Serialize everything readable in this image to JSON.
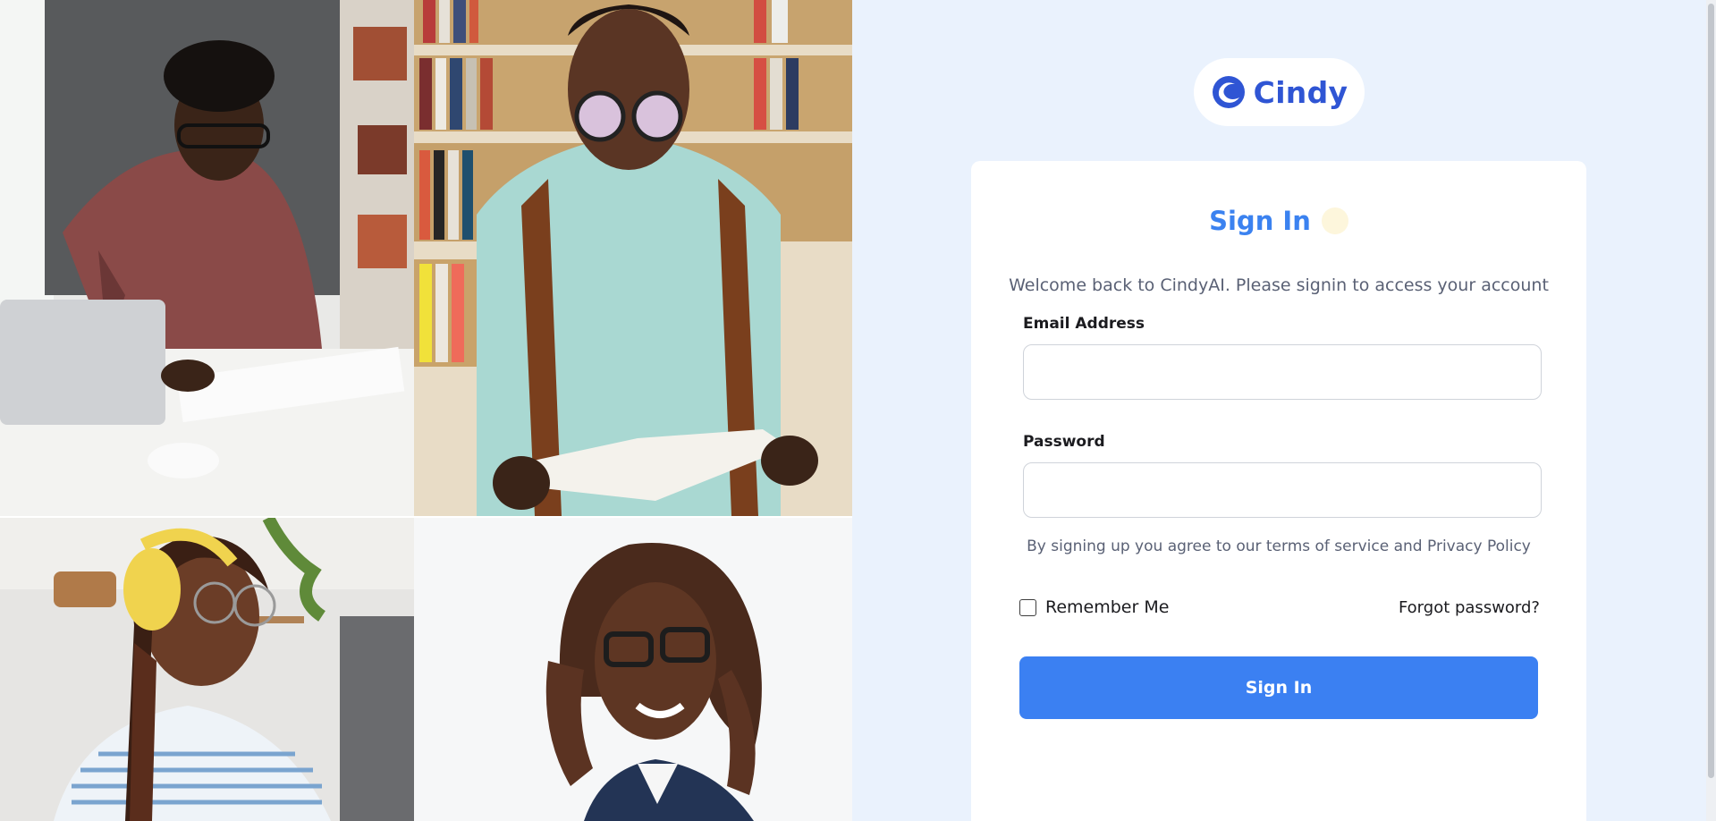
{
  "brand": {
    "name": "Cindy",
    "icon": "cindy-wave-logo-icon",
    "color": "#2f55d4"
  },
  "signin": {
    "title": "Sign In",
    "welcome": "Welcome back to CindyAI. Please signin to access your account",
    "email_label": "Email Address",
    "email_value": "",
    "email_placeholder": "",
    "password_label": "Password",
    "password_value": "",
    "password_placeholder": "",
    "terms_prefix": "By signing up you agree to our terms of service and ",
    "terms_link": "Privacy Policy",
    "remember_label": "Remember Me",
    "remember_checked": false,
    "forgot_label": "Forgot password?",
    "button_label": "Sign In"
  },
  "colors": {
    "accent": "#3b80f2",
    "background": "#eaf2fd",
    "card": "#ffffff"
  },
  "photos": [
    {
      "name": "photo-man-writing-at-desk"
    },
    {
      "name": "photo-man-reading-book-in-library"
    },
    {
      "name": "photo-woman-with-headphones"
    },
    {
      "name": "photo-woman-smiling-portrait"
    }
  ]
}
